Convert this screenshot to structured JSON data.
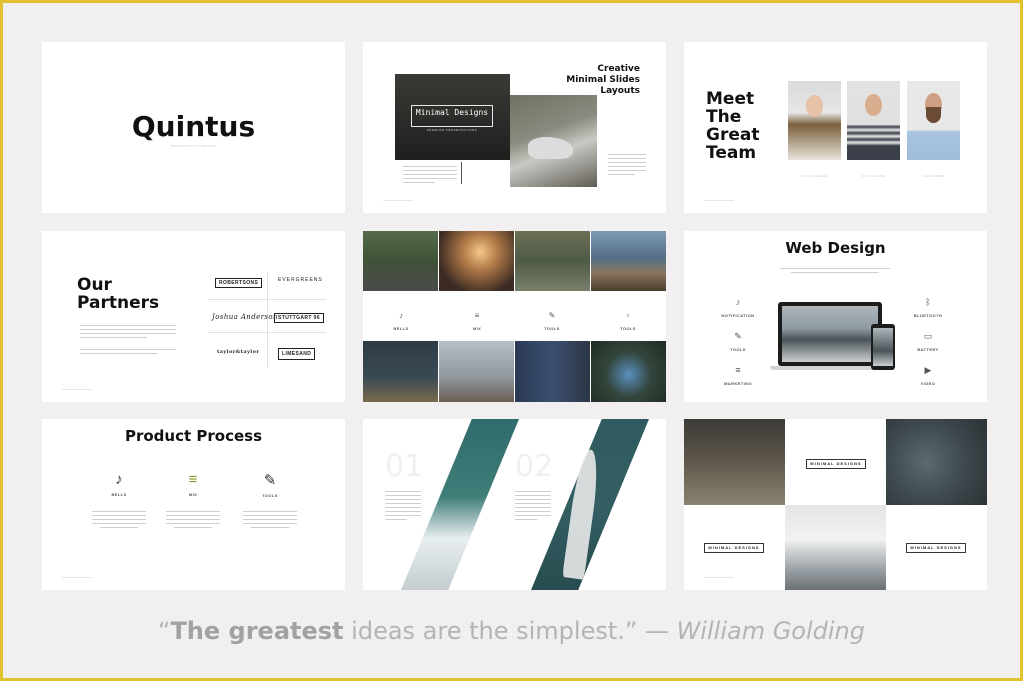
{
  "slide1": {
    "title": "Quintus",
    "subtitle": "PRESENTATION TEMPLATE"
  },
  "slide2": {
    "title_line1": "Creative",
    "title_line2": "Minimal Slides",
    "title_line3": "Layouts",
    "box_title": "Minimal Designs",
    "box_sub": "PREMIUM PRESENTATIONS"
  },
  "slide3": {
    "title_line1": "Meet",
    "title_line2": "The",
    "title_line3": "Great",
    "title_line4": "Team",
    "members": [
      "SOFIA PEREIRA",
      "PAUL CARVER",
      "IAN BARBER"
    ]
  },
  "slide4": {
    "title_line1": "Our",
    "title_line2": "Partners",
    "logos": [
      "ROBERTSONS",
      "EVERGREENS",
      "Joshua Anderson",
      "STUTTGART 96",
      "taylor&taylor",
      "LIMESAND"
    ]
  },
  "slide5": {
    "labels": [
      "BELLS",
      "MIX",
      "TOOLS",
      "TOOLS"
    ]
  },
  "slide6": {
    "title": "Web Design",
    "left_labels": [
      "NOTIFICATION",
      "TOOLS",
      "MARKETING"
    ],
    "right_labels": [
      "BLUETOOTH",
      "BATTERY",
      "VIDEO"
    ],
    "icons": {
      "left": [
        "bell-icon",
        "wrench-icon",
        "sliders-icon"
      ],
      "right": [
        "bluetooth-icon",
        "battery-icon",
        "video-icon"
      ]
    }
  },
  "slide7": {
    "title": "Product Process",
    "labels": [
      "BELLS",
      "MIX",
      "TOOLS"
    ]
  },
  "slide8": {
    "num1": "01",
    "num2": "02"
  },
  "slide9": {
    "label1": "MINIMAL DESIGNS",
    "label2": "MINIMAL DESIGNS",
    "label3": "MINIMAL DESIGNS"
  },
  "quote": {
    "open": "“",
    "bold": "The greatest",
    "rest": " ideas are the simplest.” — ",
    "author": "William Golding"
  },
  "colors": {
    "border": "#e2c12f",
    "background": "#f1eff0",
    "accent_olive": "#8a9a2c"
  }
}
